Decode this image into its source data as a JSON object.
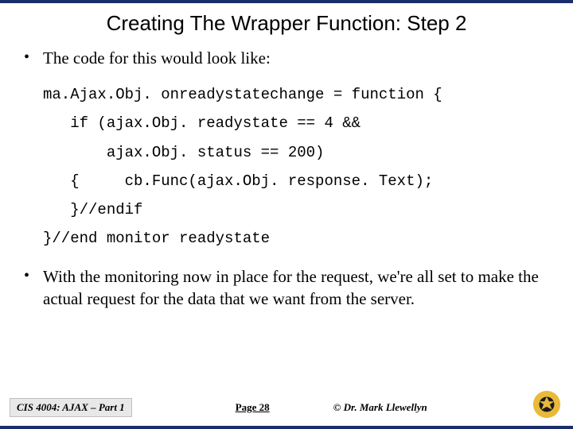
{
  "title": "Creating The Wrapper Function: Step 2",
  "bullets": {
    "b0": "The code for this would look like:",
    "b1": "With the monitoring now in place for the request, we're all set to make the actual request for the data that we want from the server."
  },
  "code": {
    "l0": "ma.Ajax.Obj. onreadystatechange = function {",
    "l1": "   if (ajax.Obj. readystate == 4 &&",
    "l2": "       ajax.Obj. status == 200)",
    "l3": "   {     cb.Func(ajax.Obj. response. Text);",
    "l4": "   }//endif",
    "l5": "}//end monitor readystate"
  },
  "footer": {
    "course": "CIS 4004: AJAX – Part 1",
    "page": "Page 28",
    "copyright": "© Dr. Mark Llewellyn"
  },
  "colors": {
    "border": "#1a2d6b",
    "logo_outer": "#e9b93a",
    "logo_inner": "#1b1b1b"
  }
}
